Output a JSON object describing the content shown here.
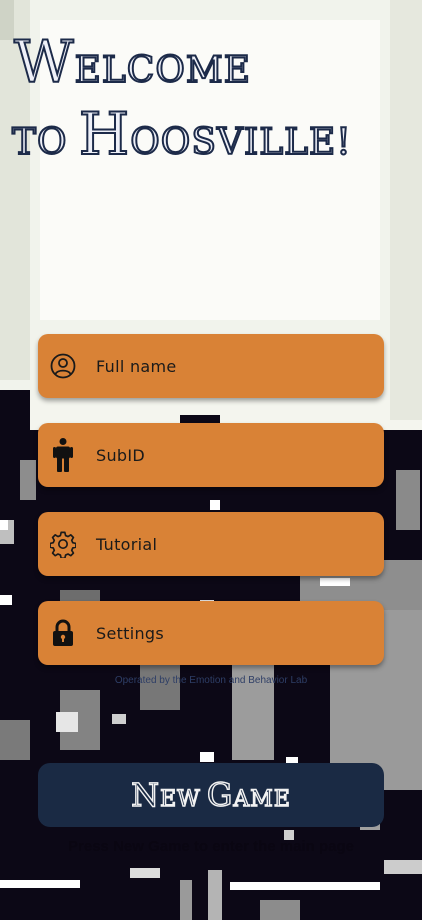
{
  "title": {
    "line1": {
      "first": "W",
      "rest": "elcome"
    },
    "line2": {
      "lead": "to",
      "first": "H",
      "rest": "oosville!"
    }
  },
  "menu": [
    {
      "label": "Full name",
      "icon": "user-circle-icon"
    },
    {
      "label": "SubID",
      "icon": "person-icon"
    },
    {
      "label": "Tutorial",
      "icon": "gear-icon"
    },
    {
      "label": "Settings",
      "icon": "lock-icon"
    }
  ],
  "credit": "Operated by the Emotion and Behavior Lab",
  "new_game": {
    "first_n": "N",
    "rest_n": "ew",
    "first_g": "G",
    "rest_g": "ame"
  },
  "hint": "Press New Game to enter the main page",
  "colors": {
    "menu_button": "#d98236",
    "new_game_button": "#1a2a44",
    "title_outline": "#1c2a49",
    "background_light": "#f4f5ee",
    "background_dark": "#0c0816"
  }
}
